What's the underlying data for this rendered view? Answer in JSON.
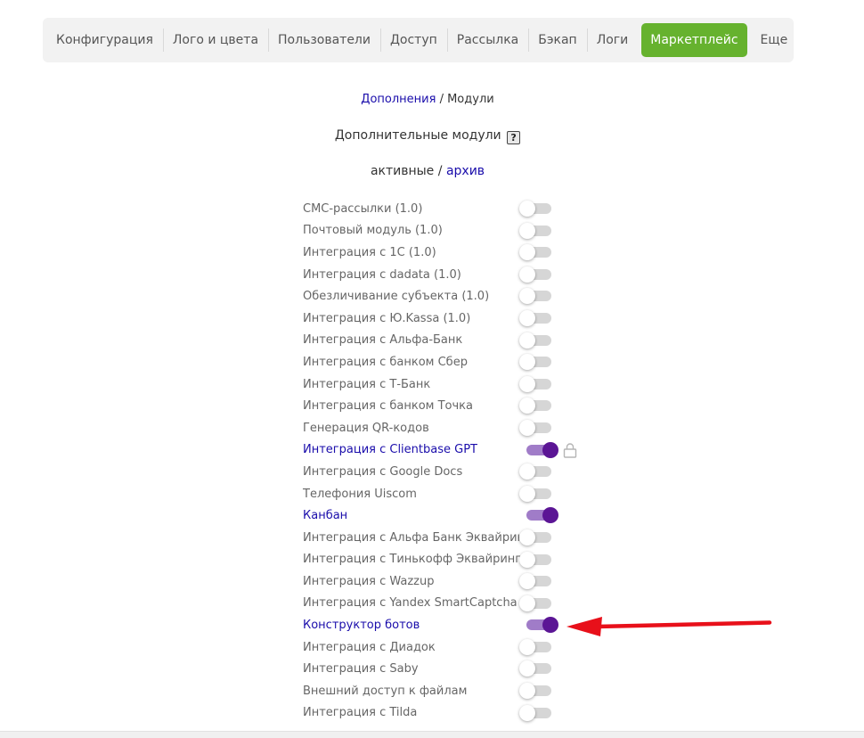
{
  "tabs": [
    {
      "label": "Конфигурация",
      "active": false
    },
    {
      "label": "Лого и цвета",
      "active": false
    },
    {
      "label": "Пользователи",
      "active": false
    },
    {
      "label": "Доступ",
      "active": false
    },
    {
      "label": "Рассылка",
      "active": false
    },
    {
      "label": "Бэкап",
      "active": false
    },
    {
      "label": "Логи",
      "active": false
    },
    {
      "label": "Маркетплейс",
      "active": true
    },
    {
      "label": "Еще",
      "active": false
    }
  ],
  "breadcrumb": {
    "parent": "Дополнения",
    "separator": " / ",
    "current": "Модули"
  },
  "section_title": "Дополнительные модули",
  "help_icon_glyph": "?",
  "filter": {
    "active": "активные",
    "separator": " / ",
    "archive": "архив"
  },
  "modules": [
    {
      "label": "СМС-рассылки (1.0)",
      "enabled": false
    },
    {
      "label": "Почтовый модуль (1.0)",
      "enabled": false
    },
    {
      "label": "Интеграция с 1С (1.0)",
      "enabled": false
    },
    {
      "label": "Интеграция с dadata (1.0)",
      "enabled": false
    },
    {
      "label": "Обезличивание субъекта (1.0)",
      "enabled": false
    },
    {
      "label": "Интеграция с Ю.Kassa (1.0)",
      "enabled": false
    },
    {
      "label": "Интеграция с Альфа-Банк",
      "enabled": false
    },
    {
      "label": "Интеграция с банком Сбер",
      "enabled": false
    },
    {
      "label": "Интеграция с Т-Банк",
      "enabled": false
    },
    {
      "label": "Интеграция с банком Точка",
      "enabled": false
    },
    {
      "label": "Генерация QR-кодов",
      "enabled": false
    },
    {
      "label": "Интеграция с Clientbase GPT",
      "enabled": true,
      "locked": true
    },
    {
      "label": "Интеграция с Google Docs",
      "enabled": false
    },
    {
      "label": "Телефония Uiscom",
      "enabled": false
    },
    {
      "label": "Канбан",
      "enabled": true
    },
    {
      "label": "Интеграция с Альфа Банк Эквайринг",
      "enabled": false
    },
    {
      "label": "Интеграция с Тинькофф Эквайринг",
      "enabled": false
    },
    {
      "label": "Интеграция с Wazzup",
      "enabled": false
    },
    {
      "label": "Интеграция с Yandex SmartCaptcha",
      "enabled": false
    },
    {
      "label": "Конструктор ботов",
      "enabled": true
    },
    {
      "label": "Интеграция с Диадок",
      "enabled": false
    },
    {
      "label": "Интеграция с Saby",
      "enabled": false
    },
    {
      "label": "Внешний доступ к файлам",
      "enabled": false
    },
    {
      "label": "Интеграция с Tilda",
      "enabled": false
    }
  ],
  "colors": {
    "active_tab": "#66b22e",
    "toggle_on_track": "#a07cc8",
    "toggle_on_knob": "#5b1595",
    "link": "#1a0dab",
    "annotation_arrow": "#e8101a"
  },
  "icons": {
    "help": "question-icon",
    "lock": "lock-icon",
    "annotation": "red-arrow"
  }
}
